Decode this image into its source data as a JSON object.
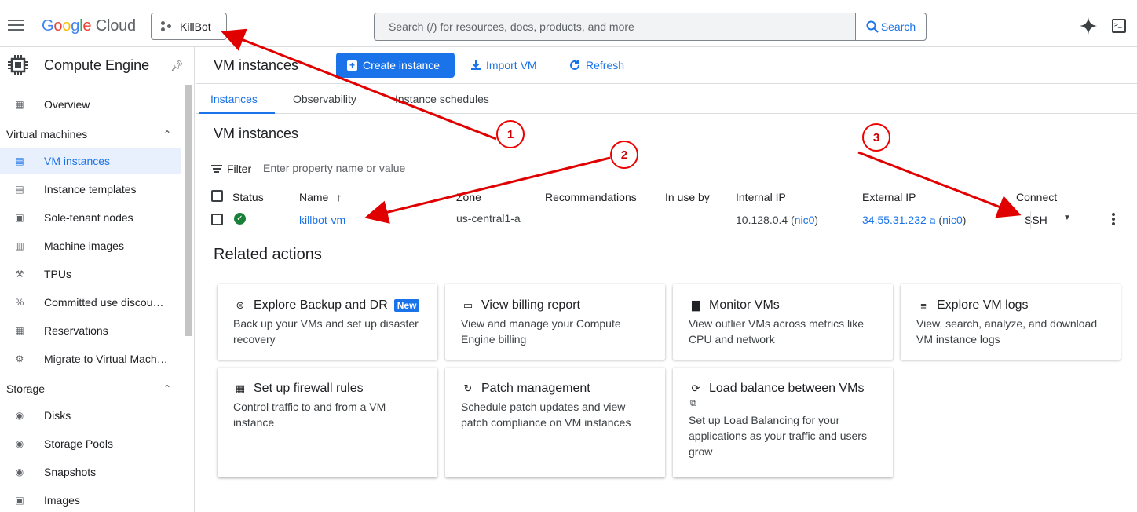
{
  "brand": {
    "g": "G",
    "o1": "o",
    "o2": "o",
    "g2": "g",
    "l": "l",
    "e": "e",
    "cloud": " Cloud"
  },
  "project": {
    "name": "KillBot"
  },
  "search": {
    "placeholder": "Search (/) for resources, docs, products, and more",
    "button": "Search"
  },
  "sidebar": {
    "title": "Compute Engine",
    "overview": "Overview",
    "sections": [
      {
        "label": "Virtual machines"
      },
      {
        "label": "Storage"
      }
    ],
    "vm_items": [
      {
        "label": "VM instances"
      },
      {
        "label": "Instance templates"
      },
      {
        "label": "Sole-tenant nodes"
      },
      {
        "label": "Machine images"
      },
      {
        "label": "TPUs"
      },
      {
        "label": "Committed use discou…"
      },
      {
        "label": "Reservations"
      },
      {
        "label": "Migrate to Virtual Mach…"
      }
    ],
    "storage_items": [
      {
        "label": "Disks"
      },
      {
        "label": "Storage Pools"
      },
      {
        "label": "Snapshots"
      },
      {
        "label": "Images"
      }
    ]
  },
  "toolbar": {
    "title": "VM instances",
    "create": "Create instance",
    "import": "Import VM",
    "refresh": "Refresh"
  },
  "tabs": [
    {
      "label": "Instances"
    },
    {
      "label": "Observability"
    },
    {
      "label": "Instance schedules"
    }
  ],
  "instances": {
    "title": "VM instances",
    "filter_label": "Filter",
    "filter_placeholder": "Enter property name or value",
    "columns": [
      "Status",
      "Name",
      "Zone",
      "Recommendations",
      "In use by",
      "Internal IP",
      "External IP",
      "Connect"
    ],
    "sort_arrow": "↑",
    "rows": [
      {
        "name": "killbot-vm",
        "zone": "us-central1-a",
        "internal_ip": "10.128.0.4",
        "internal_nic": "nic0",
        "external_ip": "34.55.31.232",
        "external_nic": "nic0",
        "connect": "SSH"
      }
    ]
  },
  "related": {
    "title": "Related actions",
    "cards": [
      {
        "title": "Explore Backup and DR",
        "badge": "New",
        "desc": "Back up your VMs and set up disaster recovery"
      },
      {
        "title": "View billing report",
        "desc": "View and manage your Compute Engine billing"
      },
      {
        "title": "Monitor VMs",
        "desc": "View outlier VMs across metrics like CPU and network"
      },
      {
        "title": "Explore VM logs",
        "desc": "View, search, analyze, and download VM instance logs"
      },
      {
        "title": "Set up firewall rules",
        "desc": "Control traffic to and from a VM instance"
      },
      {
        "title": "Patch management",
        "desc": "Schedule patch updates and view patch compliance on VM instances"
      },
      {
        "title": "Load balance between VMs",
        "desc": "Set up Load Balancing for your applications as your traffic and users grow"
      }
    ]
  },
  "annotations": [
    "1",
    "2",
    "3"
  ],
  "colors": {
    "accent": "#1a73e8",
    "annotation": "#e00000",
    "status_ok": "#188038"
  }
}
